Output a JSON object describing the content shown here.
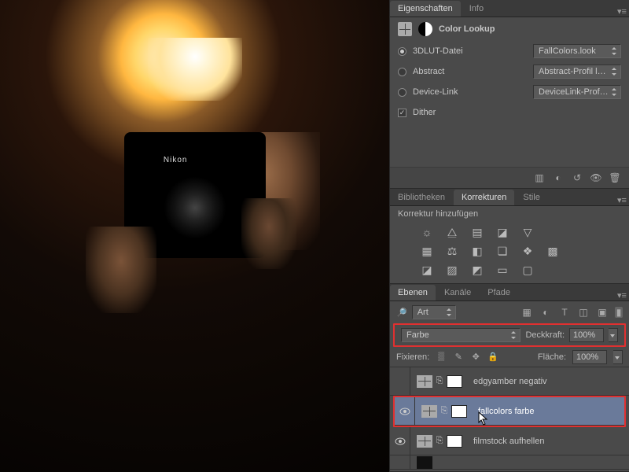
{
  "canvas": {
    "brand": "Nikon"
  },
  "properties": {
    "tabs": [
      "Eigenschaften",
      "Info"
    ],
    "title": "Color Lookup",
    "rows": {
      "lut": {
        "label": "3DLUT-Datei",
        "value": "FallColors.look"
      },
      "abstract": {
        "label": "Abstract",
        "value": "Abstract-Profil lad..."
      },
      "devicelink": {
        "label": "Device-Link",
        "value": "DeviceLink-Profil l..."
      }
    },
    "dither": "Dither"
  },
  "adjustments": {
    "tabs": [
      "Bibliotheken",
      "Korrekturen",
      "Stile"
    ],
    "subtitle": "Korrektur hinzufügen"
  },
  "layers": {
    "tabs": [
      "Ebenen",
      "Kanäle",
      "Pfade"
    ],
    "filter": "Art",
    "blend": {
      "mode": "Farbe",
      "opacity_label": "Deckkraft:",
      "opacity": "100%"
    },
    "lock": {
      "label": "Fixieren:",
      "fill_label": "Fläche:",
      "fill": "100%"
    },
    "items": [
      {
        "name": "edgyamber negativ"
      },
      {
        "name": "fallcolors farbe"
      },
      {
        "name": "filmstock aufhellen"
      }
    ]
  }
}
